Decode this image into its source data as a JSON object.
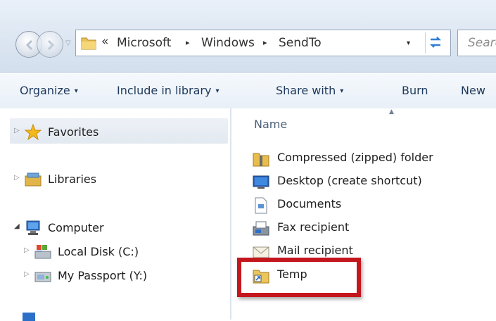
{
  "address_bar": {
    "overflow_chevron": "«",
    "breadcrumbs": [
      "Microsoft",
      "Windows",
      "SendTo"
    ],
    "separator": "▸",
    "dropdown_glyph": "▾",
    "search_placeholder": "Search"
  },
  "toolbar": {
    "items": [
      {
        "label": "Organize",
        "has_menu": true
      },
      {
        "label": "Include in library",
        "has_menu": true
      },
      {
        "label": "Share with",
        "has_menu": true
      },
      {
        "label": "Burn",
        "has_menu": false
      },
      {
        "label": "New",
        "has_menu": false
      }
    ],
    "caret": "▾"
  },
  "nav_pane": {
    "items": [
      {
        "label": "Favorites",
        "icon": "star-icon",
        "expanded": false,
        "selected": true
      },
      {
        "label": "Libraries",
        "icon": "libraries-icon",
        "expanded": false
      },
      {
        "label": "Computer",
        "icon": "computer-icon",
        "expanded": true
      },
      {
        "label": "Local Disk (C:)",
        "icon": "drive-icon",
        "expanded": false,
        "indent": 1
      },
      {
        "label": "My Passport (Y:)",
        "icon": "external-drive-icon",
        "expanded": false,
        "indent": 1
      }
    ],
    "expander_collapsed": "▷",
    "expander_expanded": "◢"
  },
  "content": {
    "column_header": "Name",
    "sort_indicator": "▲",
    "files": [
      {
        "label": "Compressed (zipped) folder",
        "icon": "zip-folder-icon"
      },
      {
        "label": "Desktop (create shortcut)",
        "icon": "desktop-icon"
      },
      {
        "label": "Documents",
        "icon": "documents-icon"
      },
      {
        "label": "Fax recipient",
        "icon": "fax-icon"
      },
      {
        "label": "Mail recipient",
        "icon": "mail-icon"
      },
      {
        "label": "Temp",
        "icon": "folder-shortcut-icon",
        "highlighted": true
      }
    ]
  },
  "colors": {
    "highlight_box": "#c4171d",
    "toolbar_text": "#1e395b",
    "chrome_gradient_top": "#e9f0f8"
  }
}
